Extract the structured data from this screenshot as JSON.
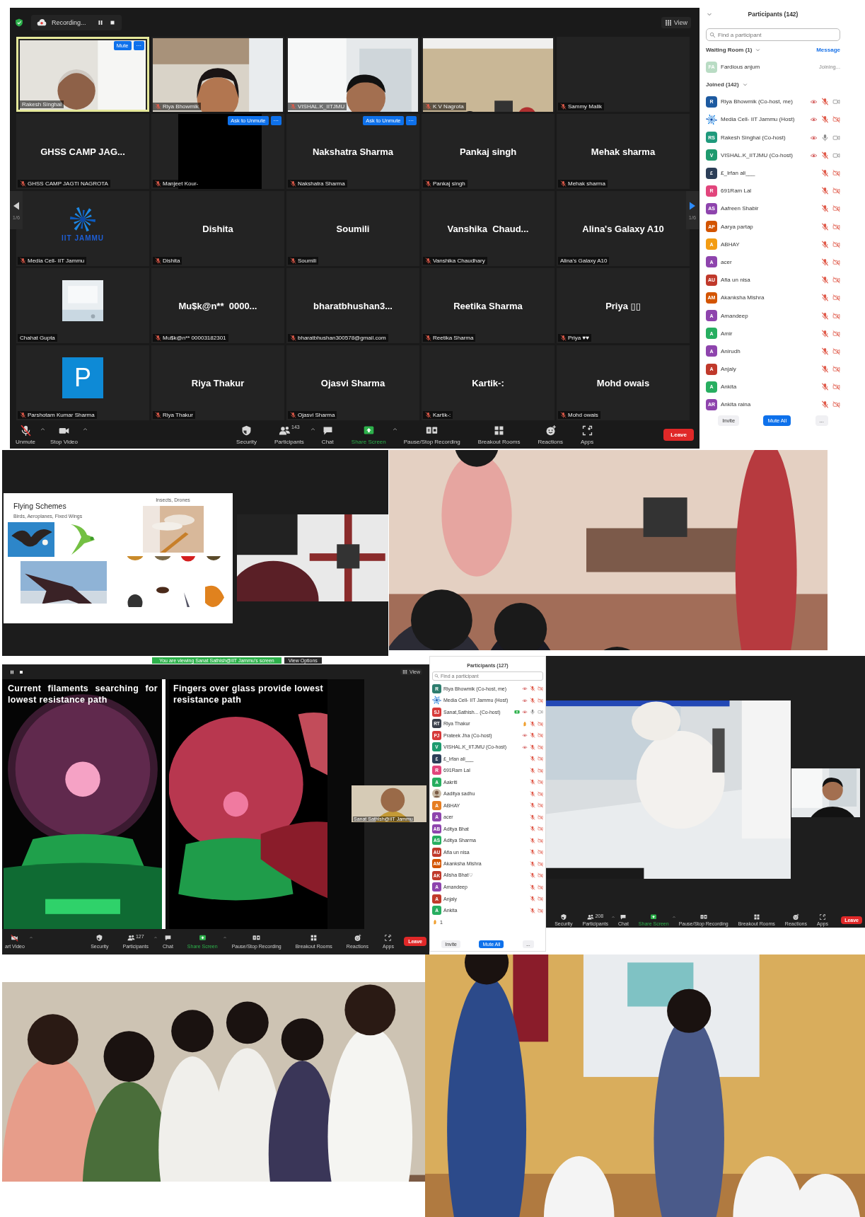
{
  "meeting": {
    "recording": {
      "label": "Recording..."
    },
    "view_label": "View",
    "pager": {
      "left": "1/6",
      "right": "1/6"
    },
    "tiles": [
      {
        "kind": "video",
        "name_tag": "Rakesh Singhai",
        "muted": false,
        "speaking": true,
        "buttons": [
          "Mute",
          "···"
        ]
      },
      {
        "kind": "video",
        "name_tag": "Riya Bhowmik",
        "muted": true,
        "speaking": false
      },
      {
        "kind": "video",
        "name_tag": "VISHAL.K_IITJMU",
        "muted": true,
        "speaking": false
      },
      {
        "kind": "video",
        "name_tag": "K V Nagrota",
        "muted": true,
        "speaking": false
      },
      {
        "kind": "blank",
        "name_tag": "Sammy Malik",
        "muted": true,
        "speaking": false
      },
      {
        "kind": "name",
        "display_name": "GHSS CAMP JAG...",
        "name_tag": "GHSS CAMP JAGTI NAGROTA",
        "muted": true,
        "speaking": false
      },
      {
        "kind": "black",
        "name_tag": "Manjeet Kour-",
        "muted": true,
        "speaking": false,
        "buttons": [
          "Ask to Unmute",
          "···"
        ]
      },
      {
        "kind": "name",
        "display_name": "Nakshatra Sharma",
        "name_tag": "Nakshatra Sharma",
        "muted": true,
        "speaking": false,
        "buttons": [
          "Ask to Unmute",
          "···"
        ]
      },
      {
        "kind": "name",
        "display_name": "Pankaj singh",
        "name_tag": "Pankaj singh",
        "muted": true,
        "speaking": false
      },
      {
        "kind": "name",
        "display_name": "Mehak sharma",
        "name_tag": "Mehak sharma",
        "muted": true,
        "speaking": false
      },
      {
        "kind": "logo",
        "logo_text": "IIT JAMMU",
        "name_tag": "Media Cell- IIT Jammu",
        "muted": true,
        "speaking": false
      },
      {
        "kind": "name",
        "display_name": "Dishita",
        "name_tag": "Dishita",
        "muted": true,
        "speaking": false
      },
      {
        "kind": "name",
        "display_name": "Soumili",
        "name_tag": "Soumili",
        "muted": true,
        "speaking": false
      },
      {
        "kind": "name",
        "display_name": "Vanshika  Chaud...",
        "name_tag": "Vanshika Chaudhary",
        "muted": true,
        "speaking": false
      },
      {
        "kind": "name",
        "display_name": "Alina's Galaxy A10",
        "name_tag": "Alina's Galaxy A10",
        "muted": false,
        "speaking": false
      },
      {
        "name_tag": "Chahat Gupta",
        "muted": false,
        "speaking": false
      },
      {
        "kind": "name",
        "display_name": "Mu$k@n**  0000...",
        "name_tag": "Mu$k@n** 00003182301",
        "muted": true,
        "speaking": false
      },
      {
        "kind": "name",
        "display_name": "bharatbhushan3...",
        "name_tag": "bharatbhushan300578@gmail.com",
        "muted": true,
        "speaking": false
      },
      {
        "kind": "name",
        "display_name": "Reetika Sharma",
        "name_tag": "Reetika Sharma",
        "muted": true,
        "speaking": false
      },
      {
        "kind": "name",
        "display_name": "Priya ▯▯",
        "name_tag": "Priya ♥♥",
        "muted": true,
        "speaking": false
      },
      {
        "kind": "initial",
        "initial": "P",
        "name_tag": "Parshotam Kumar Sharma",
        "muted": true,
        "speaking": false
      },
      {
        "kind": "name",
        "display_name": "Riya Thakur",
        "name_tag": "Riya Thakur",
        "muted": true,
        "speaking": false
      },
      {
        "kind": "name",
        "display_name": "Ojasvi Sharma",
        "name_tag": "Ojasvi Sharma",
        "muted": true,
        "speaking": false
      },
      {
        "kind": "name",
        "display_name": "Kartik-:",
        "name_tag": "Kartik-:",
        "muted": true,
        "speaking": false
      },
      {
        "kind": "name",
        "display_name": "Mohd owais",
        "name_tag": "Mohd owais",
        "muted": true,
        "speaking": false
      }
    ],
    "toolbar": {
      "left_items": [
        {
          "kind": "mic_off",
          "label": "Unmute",
          "caret": true
        },
        {
          "kind": "video",
          "label": "Stop Video",
          "caret": true
        }
      ],
      "center_items": [
        {
          "kind": "security",
          "label": "Security",
          "caret": false
        },
        {
          "kind": "participants",
          "label": "Participants",
          "count": "143",
          "caret": true
        },
        {
          "kind": "chat",
          "label": "Chat",
          "caret": false
        },
        {
          "kind": "share",
          "label": "Share Screen",
          "caret": true
        },
        {
          "kind": "record",
          "label": "Pause/Stop Recording",
          "caret": false
        },
        {
          "kind": "breakout",
          "label": "Breakout Rooms",
          "caret": false
        },
        {
          "kind": "reactions",
          "label": "Reactions",
          "caret": false
        },
        {
          "kind": "apps",
          "label": "Apps",
          "caret": false
        }
      ],
      "leave": "Leave"
    }
  },
  "participants_panel": {
    "title": "Participants (142)",
    "search_placeholder": "Find a participant",
    "waiting_room": {
      "label": "Waiting Room (1)",
      "action": "Message",
      "people": [
        {
          "initials": "FA",
          "color": "#b9dcc4",
          "name": "Fardious anjum",
          "status": "Joining..."
        }
      ]
    },
    "joined_label": "Joined (142)",
    "people": [
      {
        "kind": "initials",
        "initials": "R",
        "color": "#1d5aa0",
        "name": "Riya Bhowmik (Co-host, me)",
        "recording": true,
        "muted": true,
        "video_off": false
      },
      {
        "kind": "logo",
        "name": "Media Cell- IIT Jammu (Host)",
        "recording": true,
        "muted": true,
        "video_off": true
      },
      {
        "kind": "initials",
        "initials": "RS",
        "color": "#1f9a7c",
        "name": "Rakesh Singhai (Co-host)",
        "recording": true,
        "muted": false,
        "video_off": false
      },
      {
        "kind": "initials",
        "initials": "V",
        "color": "#1e9a6e",
        "name": "VISHAL.K_IITJMU (Co-host)",
        "recording": true,
        "muted": true,
        "video_off": false
      },
      {
        "kind": "initials",
        "initials": "£",
        "color": "#2c3e57",
        "name": "£_Irfan ali___",
        "recording": false,
        "muted": true,
        "video_off": true
      },
      {
        "kind": "initials",
        "initials": "R",
        "color": "#e2457c",
        "name": "691Ram Lal",
        "recording": false,
        "muted": true,
        "video_off": true
      },
      {
        "kind": "initials",
        "initials": "AS",
        "color": "#8e44ad",
        "name": "Aafreen Shabir",
        "recording": false,
        "muted": true,
        "video_off": true
      },
      {
        "kind": "initials",
        "initials": "AP",
        "color": "#d35400",
        "name": "Aarya partap",
        "recording": false,
        "muted": true,
        "video_off": true
      },
      {
        "kind": "initials",
        "initials": "A",
        "color": "#f39c12",
        "name": "ABHAY",
        "recording": false,
        "muted": true,
        "video_off": true
      },
      {
        "kind": "initials",
        "initials": "A",
        "color": "#8e44ad",
        "name": "acer",
        "recording": false,
        "muted": true,
        "video_off": true
      },
      {
        "kind": "initials",
        "initials": "AU",
        "color": "#c0392b",
        "name": "Afia un nisa",
        "recording": false,
        "muted": true,
        "video_off": true
      },
      {
        "kind": "initials",
        "initials": "AM",
        "color": "#d35400",
        "name": "Akanksha Mishra",
        "recording": false,
        "muted": true,
        "video_off": true
      },
      {
        "kind": "initials",
        "initials": "A",
        "color": "#8e44ad",
        "name": "Amandeep",
        "recording": false,
        "muted": true,
        "video_off": true
      },
      {
        "kind": "initials",
        "initials": "A",
        "color": "#27ae60",
        "name": "Amir",
        "recording": false,
        "muted": true,
        "video_off": true
      },
      {
        "kind": "initials",
        "initials": "A",
        "color": "#8e44ad",
        "name": "Anirudh",
        "recording": false,
        "muted": true,
        "video_off": true
      },
      {
        "kind": "initials",
        "initials": "A",
        "color": "#c0392b",
        "name": "Anjaly",
        "recording": false,
        "muted": true,
        "video_off": true
      },
      {
        "kind": "initials",
        "initials": "A",
        "color": "#27ae60",
        "name": "Ankita",
        "recording": false,
        "muted": true,
        "video_off": true
      },
      {
        "kind": "initials",
        "initials": "AR",
        "color": "#8e44ad",
        "name": "Ankita raina",
        "recording": false,
        "muted": true,
        "video_off": true
      }
    ],
    "buttons": [
      {
        "label": "Invite",
        "kind": "plain"
      },
      {
        "label": "Mute All",
        "kind": "primary"
      },
      {
        "label": "...",
        "kind": "plain"
      }
    ]
  },
  "slide": {
    "title": "Flying Schemes",
    "subtitle": "Birds, Aeroplanes, Fixed Wings",
    "right_heading": "Insects, Drones"
  },
  "shared_screen": {
    "banner": "You are viewing Sanat Sathish@IIT Jammu's screen",
    "view_options": "View Options",
    "view_label": "View",
    "slides": [
      {
        "caption": "Current filaments searching for lowest resistance path"
      },
      {
        "caption": "Fingers over glass provide lowest resistance path"
      }
    ],
    "self_view_name": "Sanat Sathish@IIT Jammu",
    "toolbar": {
      "left_items": [
        {
          "kind": "video_off",
          "label": "art Video",
          "caret": true
        }
      ],
      "center_items": [
        {
          "kind": "security",
          "label": "Security",
          "caret": false
        },
        {
          "kind": "participants",
          "label": "Participants",
          "count": "127",
          "caret": true
        },
        {
          "kind": "chat",
          "label": "Chat",
          "caret": false
        },
        {
          "kind": "share",
          "label": "Share Screen",
          "caret": true
        },
        {
          "kind": "record",
          "label": "Pause/Stop Recording",
          "caret": false
        },
        {
          "kind": "breakout",
          "label": "Breakout Rooms",
          "caret": false
        },
        {
          "kind": "reactions",
          "label": "Reactions",
          "caret": false
        },
        {
          "kind": "apps",
          "label": "Apps",
          "caret": false
        }
      ],
      "leave": "Leave"
    }
  },
  "mini_panel": {
    "title": "Participants (127)",
    "search_placeholder": "Find a participant",
    "people": [
      {
        "kind": "initials",
        "initials": "R",
        "color": "#2d7d6e",
        "name": "Riya Bhowmik (Co-host, me)",
        "sharing": false,
        "hand": false,
        "recording": true,
        "muted": true,
        "video_off": true
      },
      {
        "kind": "logo",
        "name": "Media Cell- IIT Jammu (Host)",
        "sharing": false,
        "hand": false,
        "recording": true,
        "muted": true,
        "video_off": true
      },
      {
        "kind": "initials",
        "initials": "SJ",
        "color": "#d63a3a",
        "name": "Sanat,Sathish... (Co-host)",
        "sharing": true,
        "hand": false,
        "recording": true,
        "muted": false,
        "video_off": false
      },
      {
        "kind": "initials",
        "initials": "RT",
        "color": "#3a3f4a",
        "name": "Riya Thakur",
        "sharing": false,
        "hand": true,
        "recording": false,
        "muted": true,
        "video_off": true
      },
      {
        "kind": "initials",
        "initials": "PJ",
        "color": "#d63a3a",
        "name": "Prateek Jha (Co-host)",
        "sharing": false,
        "hand": false,
        "recording": true,
        "muted": true,
        "video_off": true
      },
      {
        "kind": "initials",
        "initials": "V",
        "color": "#1e9a6e",
        "name": "VISHAL.K_IITJMU (Co-host)",
        "sharing": false,
        "hand": false,
        "recording": true,
        "muted": true,
        "video_off": true
      },
      {
        "kind": "initials",
        "initials": "£",
        "color": "#2c3e57",
        "name": "£_Irfan ali___",
        "sharing": false,
        "hand": false,
        "recording": false,
        "muted": true,
        "video_off": true
      },
      {
        "kind": "initials",
        "initials": "R",
        "color": "#e2457c",
        "name": "691Ram Lal",
        "sharing": false,
        "hand": false,
        "recording": false,
        "muted": true,
        "video_off": true
      },
      {
        "kind": "initials",
        "initials": "A",
        "color": "#27ae60",
        "name": "Aakriti",
        "sharing": false,
        "hand": false,
        "recording": false,
        "muted": true,
        "video_off": true
      },
      {
        "name": "Aaditya sadhu",
        "sharing": false,
        "hand": false,
        "recording": false,
        "muted": true,
        "video_off": true
      },
      {
        "kind": "initials",
        "initials": "A",
        "color": "#e67e22",
        "name": "ABHAY",
        "sharing": false,
        "hand": false,
        "recording": false,
        "muted": true,
        "video_off": true
      },
      {
        "kind": "initials",
        "initials": "A",
        "color": "#8e44ad",
        "name": "acer",
        "sharing": false,
        "hand": false,
        "recording": false,
        "muted": true,
        "video_off": true
      },
      {
        "kind": "initials",
        "initials": "AB",
        "color": "#8e44ad",
        "name": "Aditya Bhat",
        "sharing": false,
        "hand": false,
        "recording": false,
        "muted": true,
        "video_off": true
      },
      {
        "kind": "initials",
        "initials": "AS",
        "color": "#27ae60",
        "name": "Aditya Sharma",
        "sharing": false,
        "hand": false,
        "recording": false,
        "muted": true,
        "video_off": true
      },
      {
        "kind": "initials",
        "initials": "AU",
        "color": "#c0392b",
        "name": "Afia un nisa",
        "sharing": false,
        "hand": false,
        "recording": false,
        "muted": true,
        "video_off": true
      },
      {
        "kind": "initials",
        "initials": "AM",
        "color": "#d35400",
        "name": "Akanksha Mishra",
        "sharing": false,
        "hand": false,
        "recording": false,
        "muted": true,
        "video_off": true
      },
      {
        "kind": "initials",
        "initials": "AK",
        "color": "#c0392b",
        "name": "Alisha Bhat♡",
        "sharing": false,
        "hand": false,
        "recording": false,
        "muted": true,
        "video_off": true
      },
      {
        "kind": "initials",
        "initials": "A",
        "color": "#8e44ad",
        "name": "Amandeep",
        "sharing": false,
        "hand": false,
        "recording": false,
        "muted": true,
        "video_off": true
      },
      {
        "kind": "initials",
        "initials": "A",
        "color": "#c0392b",
        "name": "Anjaly",
        "sharing": false,
        "hand": false,
        "recording": false,
        "muted": true,
        "video_off": true
      },
      {
        "kind": "initials",
        "initials": "A",
        "color": "#27ae60",
        "name": "Ankita",
        "sharing": false,
        "hand": false,
        "recording": false,
        "muted": true,
        "video_off": true
      }
    ],
    "raised_hands": "1",
    "buttons": [
      {
        "label": "Invite",
        "kind": "plain"
      },
      {
        "label": "Mute All",
        "kind": "primary"
      },
      {
        "label": "...",
        "kind": "plain"
      }
    ]
  },
  "lab_screen": {
    "toolbar": {
      "center_items": [
        {
          "kind": "security",
          "label": "Security",
          "caret": false
        },
        {
          "kind": "participants",
          "label": "Participants",
          "count": "208",
          "caret": true
        },
        {
          "kind": "chat",
          "label": "Chat",
          "caret": false
        },
        {
          "kind": "share",
          "label": "Share Screen",
          "caret": true
        },
        {
          "kind": "record",
          "label": "Pause/Stop Recording",
          "caret": false
        },
        {
          "kind": "breakout",
          "label": "Breakout Rooms",
          "caret": false
        },
        {
          "kind": "reactions",
          "label": "Reactions",
          "caret": false
        },
        {
          "kind": "apps",
          "label": "Apps",
          "caret": false
        }
      ],
      "leave": "Leave"
    }
  }
}
